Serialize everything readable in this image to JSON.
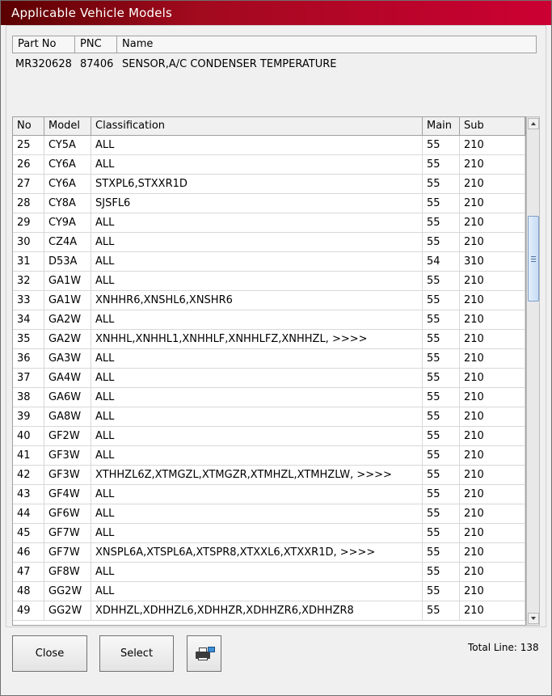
{
  "window": {
    "title": "Applicable Vehicle Models"
  },
  "part_info": {
    "headers": [
      "Part No",
      "PNC",
      "Name"
    ],
    "values": [
      "MR320628",
      "87406",
      "SENSOR,A/C CONDENSER TEMPERATURE"
    ]
  },
  "grid": {
    "headers": [
      "No",
      "Model",
      "Classification",
      "Main",
      "Sub"
    ],
    "rows": [
      [
        "25",
        "CY5A",
        "ALL",
        "55",
        "210"
      ],
      [
        "26",
        "CY6A",
        "ALL",
        "55",
        "210"
      ],
      [
        "27",
        "CY6A",
        "STXPL6,STXXR1D",
        "55",
        "210"
      ],
      [
        "28",
        "CY8A",
        "SJSFL6",
        "55",
        "210"
      ],
      [
        "29",
        "CY9A",
        "ALL",
        "55",
        "210"
      ],
      [
        "30",
        "CZ4A",
        "ALL",
        "55",
        "210"
      ],
      [
        "31",
        "D53A",
        "ALL",
        "54",
        "310"
      ],
      [
        "32",
        "GA1W",
        "ALL",
        "55",
        "210"
      ],
      [
        "33",
        "GA1W",
        "XNHHR6,XNSHL6,XNSHR6",
        "55",
        "210"
      ],
      [
        "34",
        "GA2W",
        "ALL",
        "55",
        "210"
      ],
      [
        "35",
        "GA2W",
        "XNHHL,XNHHL1,XNHHLF,XNHHLFZ,XNHHZL,   >>>>",
        "55",
        "210"
      ],
      [
        "36",
        "GA3W",
        "ALL",
        "55",
        "210"
      ],
      [
        "37",
        "GA4W",
        "ALL",
        "55",
        "210"
      ],
      [
        "38",
        "GA6W",
        "ALL",
        "55",
        "210"
      ],
      [
        "39",
        "GA8W",
        "ALL",
        "55",
        "210"
      ],
      [
        "40",
        "GF2W",
        "ALL",
        "55",
        "210"
      ],
      [
        "41",
        "GF3W",
        "ALL",
        "55",
        "210"
      ],
      [
        "42",
        "GF3W",
        "XTHHZL6Z,XTMGZL,XTMGZR,XTMHZL,XTMHZLW,   >>>>",
        "55",
        "210"
      ],
      [
        "43",
        "GF4W",
        "ALL",
        "55",
        "210"
      ],
      [
        "44",
        "GF6W",
        "ALL",
        "55",
        "210"
      ],
      [
        "45",
        "GF7W",
        "ALL",
        "55",
        "210"
      ],
      [
        "46",
        "GF7W",
        "XNSPL6A,XTSPL6A,XTSPR8,XTXXL6,XTXXR1D,   >>>>",
        "55",
        "210"
      ],
      [
        "47",
        "GF8W",
        "ALL",
        "55",
        "210"
      ],
      [
        "48",
        "GG2W",
        "ALL",
        "55",
        "210"
      ],
      [
        "49",
        "GG2W",
        "XDHHZL,XDHHZL6,XDHHZR,XDHHZR6,XDHHZR8",
        "55",
        "210"
      ]
    ]
  },
  "buttons": {
    "close": "Close",
    "select": "Select"
  },
  "footer": {
    "total_label": "Total Line:",
    "total_value": "138"
  },
  "icons": {
    "print": "printer-icon",
    "scroll_up": "chevron-up-icon",
    "scroll_down": "chevron-down-icon"
  },
  "colors": {
    "title_bar_start": "#5a0000",
    "title_bar_end": "#cc0033",
    "title_text": "#ffffff"
  }
}
